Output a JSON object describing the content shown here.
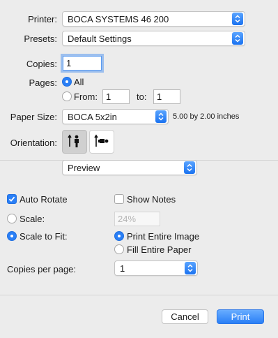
{
  "printer": {
    "label": "Printer:",
    "value": "BOCA SYSTEMS 46 200"
  },
  "presets": {
    "label": "Presets:",
    "value": "Default Settings"
  },
  "copies": {
    "label": "Copies:",
    "value": "1"
  },
  "pages": {
    "label": "Pages:",
    "all_label": "All",
    "from_label": "From:",
    "from_value": "1",
    "to_label": "to:",
    "to_value": "1",
    "selected": "All"
  },
  "paper_size": {
    "label": "Paper Size:",
    "value": "BOCA 5x2in",
    "dimensions": "5.00 by 2.00 inches"
  },
  "orientation": {
    "label": "Orientation:",
    "selected": "portrait"
  },
  "section_popup": {
    "value": "Preview"
  },
  "preview": {
    "auto_rotate_label": "Auto Rotate",
    "auto_rotate_checked": true,
    "show_notes_label": "Show Notes",
    "show_notes_checked": false,
    "scale_label": "Scale:",
    "scale_value": "24%",
    "scale_to_fit_label": "Scale to Fit:",
    "scale_mode": "Scale to Fit",
    "print_entire_image_label": "Print Entire Image",
    "fill_entire_paper_label": "Fill Entire Paper",
    "fit_mode": "Print Entire Image",
    "copies_per_page_label": "Copies per page:",
    "copies_per_page_value": "1"
  },
  "buttons": {
    "cancel": "Cancel",
    "print": "Print"
  },
  "colors": {
    "accent": "#2a7ff6",
    "background": "#ececec"
  }
}
